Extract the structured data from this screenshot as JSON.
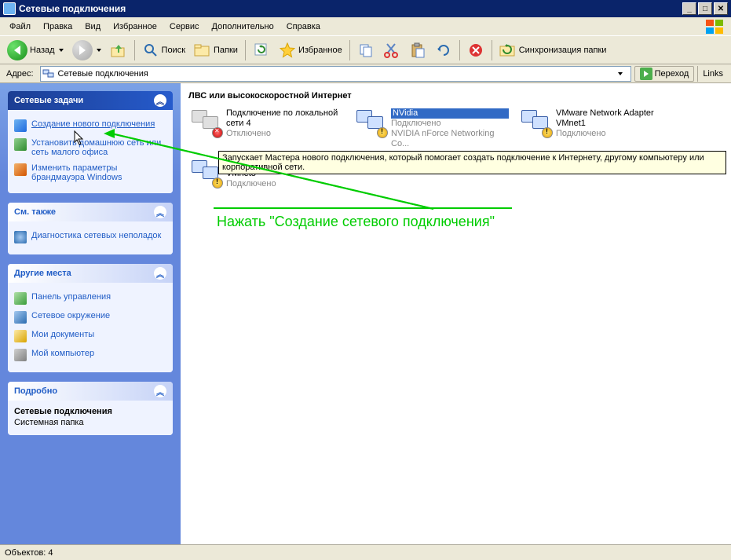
{
  "window": {
    "title": "Сетевые подключения"
  },
  "menu": {
    "file": "Файл",
    "edit": "Правка",
    "view": "Вид",
    "favorites": "Избранное",
    "tools": "Сервис",
    "extra": "Дополнительно",
    "help": "Справка"
  },
  "toolbar": {
    "back": "Назад",
    "search": "Поиск",
    "folders": "Папки",
    "favorites": "Избранное",
    "sync": "Синхронизация папки"
  },
  "address": {
    "label": "Адрес:",
    "value": "Сетевые подключения",
    "go": "Переход",
    "links": "Links"
  },
  "sidebar": {
    "tasks": {
      "title": "Сетевые задачи",
      "items": [
        {
          "label": "Создание нового подключения"
        },
        {
          "label": "Установить домашнюю сеть или сеть малого офиса"
        },
        {
          "label": "Изменить параметры брандмауэра Windows"
        }
      ]
    },
    "see_also": {
      "title": "См. также",
      "items": [
        {
          "label": "Диагностика сетевых неполадок"
        }
      ]
    },
    "other": {
      "title": "Другие места",
      "items": [
        {
          "label": "Панель управления"
        },
        {
          "label": "Сетевое окружение"
        },
        {
          "label": "Мои документы"
        },
        {
          "label": "Мой компьютер"
        }
      ]
    },
    "details": {
      "title": "Подробно",
      "name": "Сетевые подключения",
      "type": "Системная папка"
    }
  },
  "content": {
    "group": "ЛВС или высокоскоростной Интернет",
    "connections": [
      {
        "name": "Подключение по локальной сети 4",
        "status": "Отключено",
        "sub": "",
        "state": "disabled",
        "badge": "off"
      },
      {
        "name": "NVidia",
        "status": "Подключено",
        "sub": "NVIDIA nForce Networking Co...",
        "state": "selected",
        "badge": "warn"
      },
      {
        "name": "VMware Network Adapter VMnet1",
        "status": "Подключено",
        "sub": "",
        "state": "on",
        "badge": "warn"
      },
      {
        "name": "VMware Network Adapter VMnet8",
        "status": "Подключено",
        "sub": "",
        "state": "on",
        "badge": "warn"
      }
    ]
  },
  "tooltip": "Запускает Мастера нового подключения, который помогает создать подключение к Интернету, другому компьютеру или корпоративной сети.",
  "statusbar": "Объектов: 4",
  "annotation": "Нажать \"Создание сетевого подключения\""
}
